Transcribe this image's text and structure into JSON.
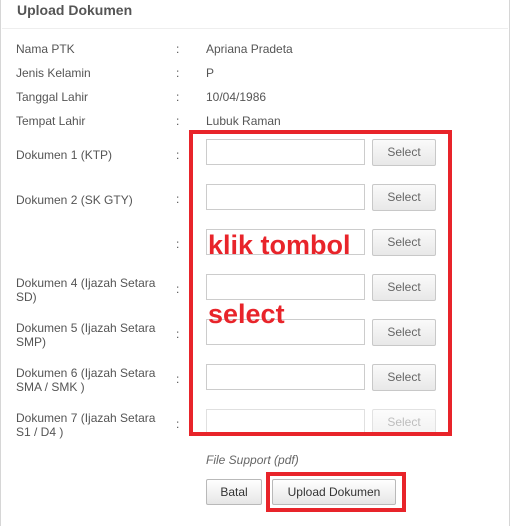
{
  "dialog": {
    "title": "Upload Dokumen"
  },
  "info": [
    {
      "label": "Nama PTK",
      "value": "Apriana Pradeta"
    },
    {
      "label": "Jenis Kelamin",
      "value": "P"
    },
    {
      "label": "Tanggal Lahir",
      "value": "10/04/1986"
    },
    {
      "label": "Tempat Lahir",
      "value": "Lubuk Raman"
    }
  ],
  "separator": ":",
  "documents": [
    {
      "label_line1": "Dokumen 1 (KTP)",
      "label_line2": "",
      "button": "Select",
      "enabled": true
    },
    {
      "label_line1": "Dokumen 2 (SK GTY)",
      "label_line2": "",
      "button": "Select",
      "enabled": true
    },
    {
      "label_line1": "",
      "label_line2": "",
      "button": "Select",
      "enabled": true
    },
    {
      "label_line1": "Dokumen 4 (Ijazah Setara",
      "label_line2": "SD)",
      "button": "Select",
      "enabled": true
    },
    {
      "label_line1": "Dokumen 5 (Ijazah Setara",
      "label_line2": "SMP)",
      "button": "Select",
      "enabled": true
    },
    {
      "label_line1": "Dokumen 6 (Ijazah Setara",
      "label_line2": "SMA / SMK )",
      "button": "Select",
      "enabled": true
    },
    {
      "label_line1": "Dokumen 7 (Ijazah Setara",
      "label_line2": "S1 / D4 )",
      "button": "Select",
      "enabled": false
    }
  ],
  "file_support": "File Support (pdf)",
  "actions": {
    "cancel_label": "Batal",
    "upload_label": "Upload Dokumen"
  },
  "annotation": {
    "line1": "klik tombol",
    "line2": "select",
    "color": "#e8242a"
  }
}
